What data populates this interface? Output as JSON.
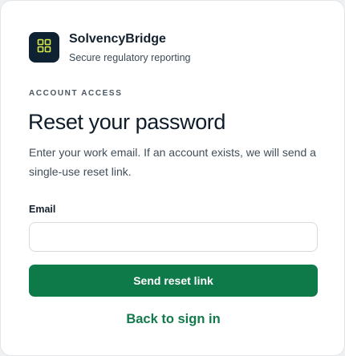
{
  "brand": {
    "name": "SolvencyBridge",
    "tagline": "Secure regulatory reporting",
    "logo_icon": "grid-icon",
    "logo_bg": "#0f2233",
    "logo_fg": "#d9e84a"
  },
  "form": {
    "eyebrow": "ACCOUNT ACCESS",
    "title": "Reset your password",
    "description": "Enter your work email. If an account exists, we will send a single-use reset link.",
    "email_label": "Email",
    "email_value": "",
    "email_placeholder": "",
    "submit_label": "Send reset link",
    "back_link_label": "Back to sign in"
  },
  "colors": {
    "primary": "#0f7a49",
    "link": "#137a4b"
  }
}
